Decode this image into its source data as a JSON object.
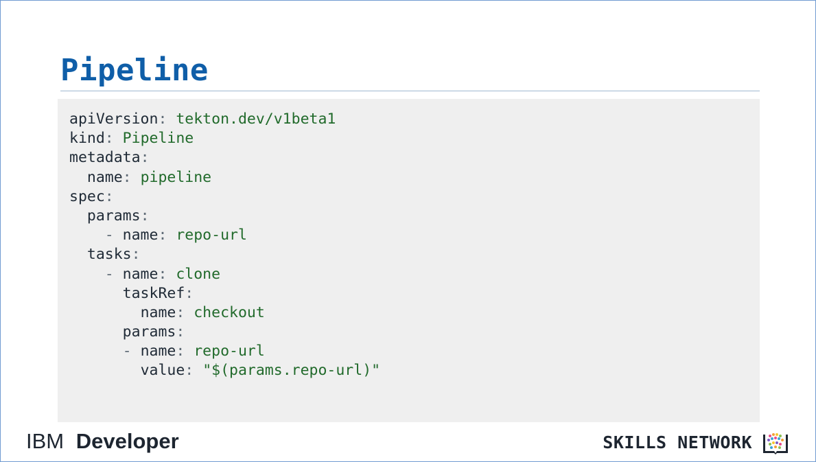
{
  "slide": {
    "title": "Pipeline"
  },
  "code": {
    "lines": [
      {
        "indent": "",
        "key": "apiVersion",
        "sep": ":",
        "value": " tekton.dev/v1beta1"
      },
      {
        "indent": "",
        "key": "kind",
        "sep": ":",
        "value": " Pipeline"
      },
      {
        "indent": "",
        "key": "metadata",
        "sep": ":",
        "value": ""
      },
      {
        "indent": "  ",
        "key": "name",
        "sep": ":",
        "value": " pipeline"
      },
      {
        "indent": "",
        "key": "spec",
        "sep": ":",
        "value": ""
      },
      {
        "indent": "  ",
        "key": "params",
        "sep": ":",
        "value": ""
      },
      {
        "indent": "    - ",
        "key": "name",
        "sep": ":",
        "value": " repo-url"
      },
      {
        "indent": "  ",
        "key": "tasks",
        "sep": ":",
        "value": ""
      },
      {
        "indent": "    - ",
        "key": "name",
        "sep": ":",
        "value": " clone"
      },
      {
        "indent": "      ",
        "key": "taskRef",
        "sep": ":",
        "value": ""
      },
      {
        "indent": "        ",
        "key": "name",
        "sep": ":",
        "value": " checkout"
      },
      {
        "indent": "      ",
        "key": "params",
        "sep": ":",
        "value": ""
      },
      {
        "indent": "      - ",
        "key": "name",
        "sep": ":",
        "value": " repo-url"
      },
      {
        "indent": "        ",
        "key": "value",
        "sep": ":",
        "value": " \"$(params.repo-url)\""
      }
    ]
  },
  "footer": {
    "brand": "IBM",
    "product": "Developer",
    "network": "SKILLS NETWORK",
    "logo_icon": "skills-network-book-icon"
  },
  "colors": {
    "title": "#0f5ea8",
    "code_value": "#216a2b",
    "code_background": "#efefef",
    "text": "#1d2530"
  }
}
